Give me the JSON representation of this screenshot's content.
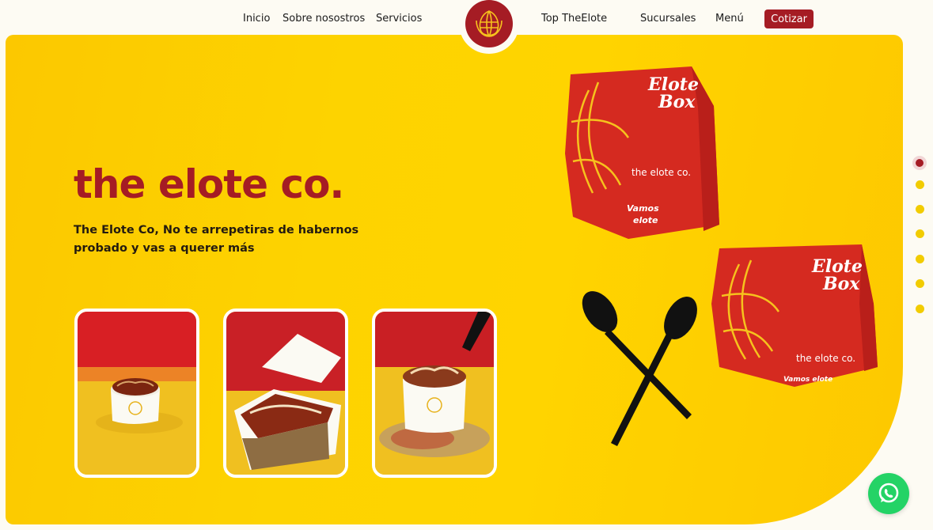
{
  "nav": {
    "inicio": "Inicio",
    "sobre": "Sobre nosostros",
    "servicios": "Servicios",
    "top": "Top TheElote",
    "sucursales": "Sucursales",
    "menu": "Menú",
    "cotizar": "Cotizar"
  },
  "hero": {
    "title": "the elote co.",
    "description": "The Elote Co, No te arrepetiras de habernos probado y vas a querer más"
  },
  "box_top": {
    "brand_line1": "Elote",
    "brand_line2": "Box",
    "company": "the elote co.",
    "slogan_line1": "Vamos",
    "slogan_line2": "elote"
  },
  "box_bottom": {
    "brand_line1": "Elote",
    "brand_line2": "Box",
    "company": "the elote co.",
    "slogan": "Vamos elote"
  },
  "cards": [
    {
      "name": "elote-cup-photo"
    },
    {
      "name": "elote-box-photo"
    },
    {
      "name": "elote-cup-chile-photo"
    }
  ],
  "carousel": {
    "count": 7,
    "active_index": 0
  },
  "colors": {
    "brand_red": "#a51c24",
    "hero_yellow": "#fdd300",
    "whatsapp_green": "#24d366",
    "dot_yellow": "#f2cc00"
  },
  "icons": [
    "corn-logo-icon",
    "whatsapp-icon"
  ]
}
